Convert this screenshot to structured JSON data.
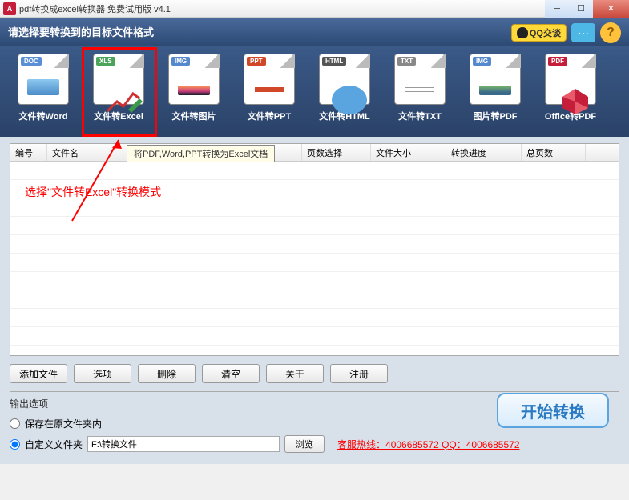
{
  "titlebar": {
    "title": "pdf转换成excel转换器 免费试用版 v4.1"
  },
  "header": {
    "prompt": "请选择要转换到的目标文件格式",
    "qq_label": "QQ交谈",
    "help_label": "?"
  },
  "formats": [
    {
      "tag": "DOC",
      "tag_color": "#5a8fd6",
      "label": "文件转Word"
    },
    {
      "tag": "XLS",
      "tag_color": "#4ca45a",
      "label": "文件转Excel"
    },
    {
      "tag": "IMG",
      "tag_color": "#5588cc",
      "label": "文件转图片"
    },
    {
      "tag": "PPT",
      "tag_color": "#d04828",
      "label": "文件转PPT"
    },
    {
      "tag": "HTML",
      "tag_color": "#555",
      "label": "文件转HTML"
    },
    {
      "tag": "TXT",
      "tag_color": "#888",
      "label": "文件转TXT"
    },
    {
      "tag": "IMG",
      "tag_color": "#5588cc",
      "label": "图片转PDF"
    },
    {
      "tag": "PDF",
      "tag_color": "#c41e3a",
      "label": "Office转PDF"
    }
  ],
  "tooltip": "将PDF,Word,PPT转换为Excel文档",
  "table": {
    "columns": [
      "编号",
      "文件名",
      "页数选择",
      "文件大小",
      "转换进度",
      "总页数"
    ]
  },
  "annotation": "选择\"文件转Excel\"转换模式",
  "actions": {
    "add": "添加文件",
    "options": "选项",
    "delete": "删除",
    "clear": "清空",
    "about": "关于",
    "register": "注册"
  },
  "output": {
    "title": "输出选项",
    "save_original": "保存在原文件夹内",
    "custom_folder": "自定义文件夹",
    "folder_path": "F:\\转换文件",
    "browse": "浏览",
    "hotline": "客服热线：4006685572 QQ：4006685572"
  },
  "start_button": "开始转换"
}
